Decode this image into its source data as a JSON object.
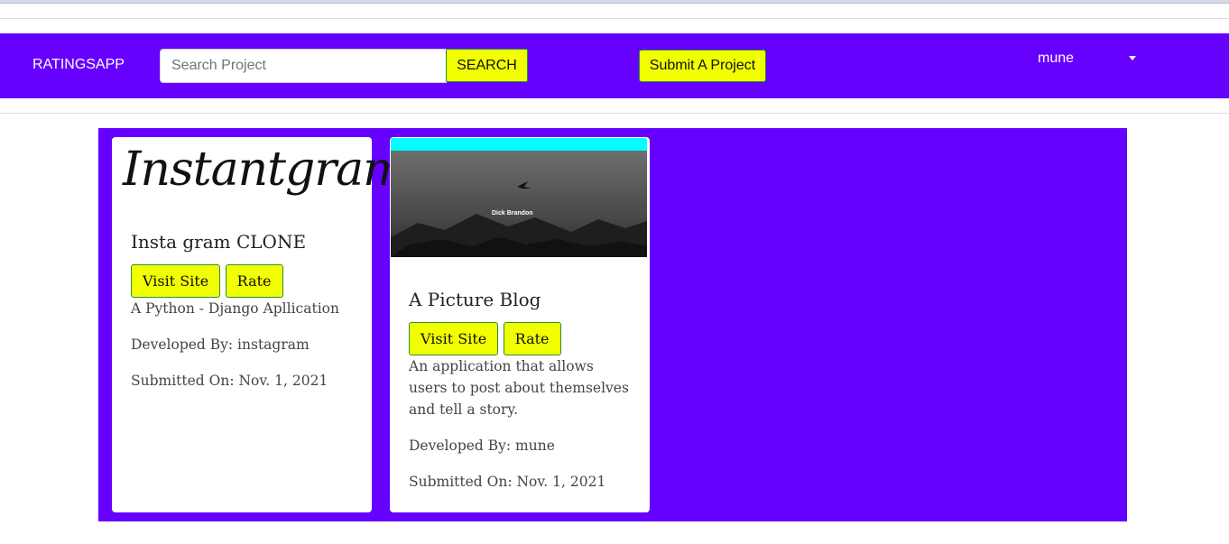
{
  "navbar": {
    "brand": "RATINGSAPP",
    "search_placeholder": "Search Project",
    "search_button": "SEARCH",
    "submit_button": "Submit A Project",
    "user": "mune",
    "bg_color": "#6600ff",
    "accent_color": "#f2ff00"
  },
  "projects": [
    {
      "image_text": "Instantgram",
      "title": "Insta gram CLONE",
      "visit_label": "Visit Site",
      "rate_label": "Rate",
      "description": "A Python - Django Apllication",
      "developer": "Developed By: instagram",
      "submitted": "Submitted On: Nov. 1, 2021"
    },
    {
      "image_text": "Dick Brandon",
      "title": "A Picture Blog",
      "visit_label": "Visit Site",
      "rate_label": "Rate",
      "description": "An application that allows users to post about themselves and tell a story.",
      "developer": "Developed By: mune",
      "submitted": "Submitted On: Nov. 1, 2021"
    }
  ]
}
